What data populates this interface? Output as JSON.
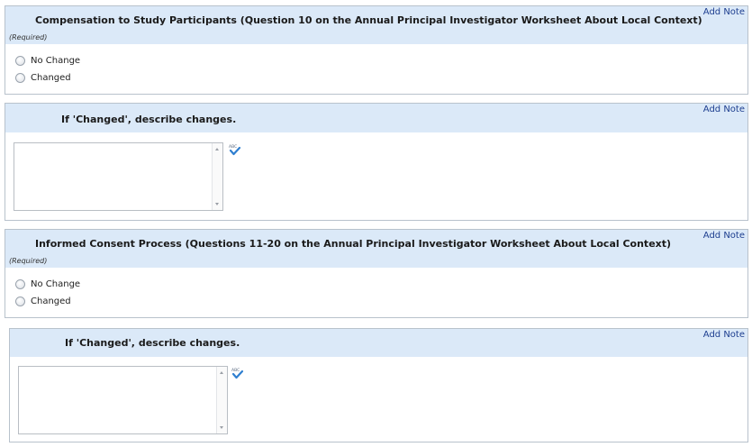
{
  "sections": [
    {
      "title": "Compensation to Study Participants (Question 10 on the Annual Principal Investigator Worksheet About Local Context)",
      "required": "(Required)",
      "add_note": "Add Note",
      "options": [
        "No Change",
        "Changed"
      ]
    },
    {
      "title": "If 'Changed', describe changes.",
      "add_note": "Add Note",
      "textarea_value": ""
    },
    {
      "title": "Informed Consent Process (Questions 11-20 on the Annual Principal Investigator Worksheet About Local Context)",
      "required": "(Required)",
      "add_note": "Add Note",
      "options": [
        "No Change",
        "Changed"
      ]
    },
    {
      "title": "If 'Changed', describe changes.",
      "add_note": "Add Note",
      "textarea_value": ""
    }
  ],
  "icons": {
    "spellcheck": "spellcheck-icon",
    "radio": "radio-icon"
  },
  "colors": {
    "header_bg": "#dbe9f8",
    "link": "#1d3e8f",
    "border": "#b8c2cc"
  }
}
